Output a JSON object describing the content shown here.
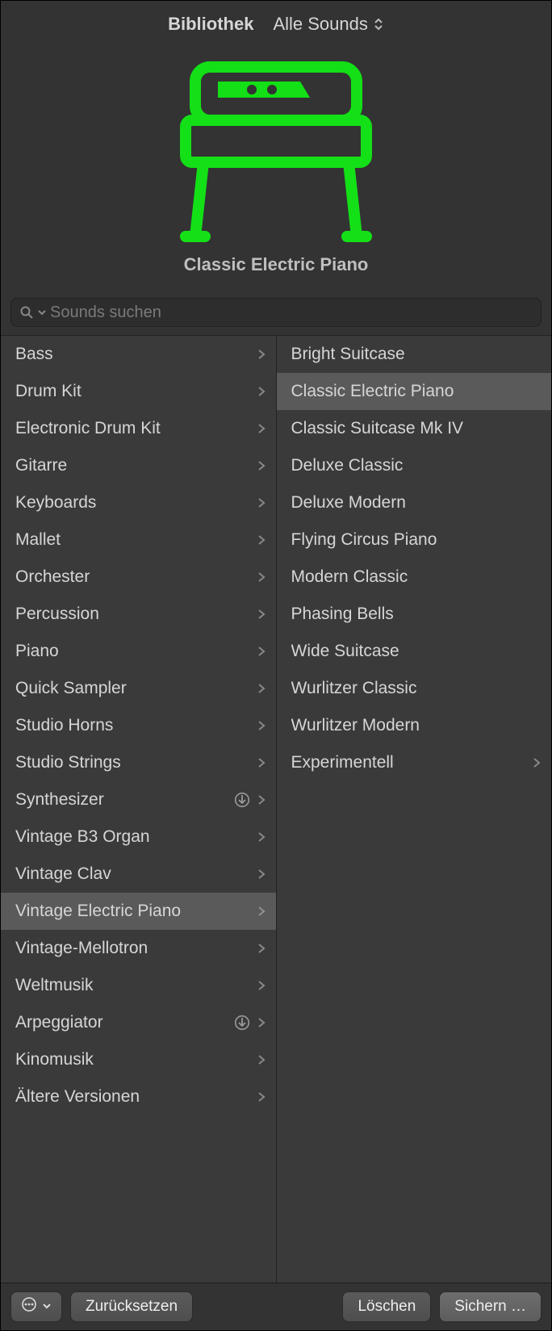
{
  "header": {
    "title": "Bibliothek",
    "dropdown_label": "Alle Sounds"
  },
  "instrument": {
    "name": "Classic Electric Piano"
  },
  "search": {
    "placeholder": "Sounds suchen"
  },
  "categories": [
    {
      "label": "Bass",
      "has_children": true,
      "download": false,
      "selected": false
    },
    {
      "label": "Drum Kit",
      "has_children": true,
      "download": false,
      "selected": false
    },
    {
      "label": "Electronic Drum Kit",
      "has_children": true,
      "download": false,
      "selected": false
    },
    {
      "label": "Gitarre",
      "has_children": true,
      "download": false,
      "selected": false
    },
    {
      "label": "Keyboards",
      "has_children": true,
      "download": false,
      "selected": false
    },
    {
      "label": "Mallet",
      "has_children": true,
      "download": false,
      "selected": false
    },
    {
      "label": "Orchester",
      "has_children": true,
      "download": false,
      "selected": false
    },
    {
      "label": "Percussion",
      "has_children": true,
      "download": false,
      "selected": false
    },
    {
      "label": "Piano",
      "has_children": true,
      "download": false,
      "selected": false
    },
    {
      "label": "Quick Sampler",
      "has_children": true,
      "download": false,
      "selected": false
    },
    {
      "label": "Studio Horns",
      "has_children": true,
      "download": false,
      "selected": false
    },
    {
      "label": "Studio Strings",
      "has_children": true,
      "download": false,
      "selected": false
    },
    {
      "label": "Synthesizer",
      "has_children": true,
      "download": true,
      "selected": false
    },
    {
      "label": "Vintage B3 Organ",
      "has_children": true,
      "download": false,
      "selected": false
    },
    {
      "label": "Vintage Clav",
      "has_children": true,
      "download": false,
      "selected": false
    },
    {
      "label": "Vintage Electric Piano",
      "has_children": true,
      "download": false,
      "selected": true
    },
    {
      "label": "Vintage-Mellotron",
      "has_children": true,
      "download": false,
      "selected": false
    },
    {
      "label": "Weltmusik",
      "has_children": true,
      "download": false,
      "selected": false
    },
    {
      "label": "Arpeggiator",
      "has_children": true,
      "download": true,
      "selected": false
    },
    {
      "label": "Kinomusik",
      "has_children": true,
      "download": false,
      "selected": false
    },
    {
      "label": "Ältere Versionen",
      "has_children": true,
      "download": false,
      "selected": false
    }
  ],
  "patches": [
    {
      "label": "Bright Suitcase",
      "has_children": false,
      "selected": false
    },
    {
      "label": "Classic Electric Piano",
      "has_children": false,
      "selected": true
    },
    {
      "label": "Classic Suitcase Mk IV",
      "has_children": false,
      "selected": false
    },
    {
      "label": "Deluxe Classic",
      "has_children": false,
      "selected": false
    },
    {
      "label": "Deluxe Modern",
      "has_children": false,
      "selected": false
    },
    {
      "label": "Flying Circus Piano",
      "has_children": false,
      "selected": false
    },
    {
      "label": "Modern Classic",
      "has_children": false,
      "selected": false
    },
    {
      "label": "Phasing Bells",
      "has_children": false,
      "selected": false
    },
    {
      "label": "Wide Suitcase",
      "has_children": false,
      "selected": false
    },
    {
      "label": "Wurlitzer Classic",
      "has_children": false,
      "selected": false
    },
    {
      "label": "Wurlitzer Modern",
      "has_children": false,
      "selected": false
    },
    {
      "label": "Experimentell",
      "has_children": true,
      "selected": false
    }
  ],
  "footer": {
    "reset_label": "Zurücksetzen",
    "delete_label": "Löschen",
    "save_label": "Sichern …"
  }
}
